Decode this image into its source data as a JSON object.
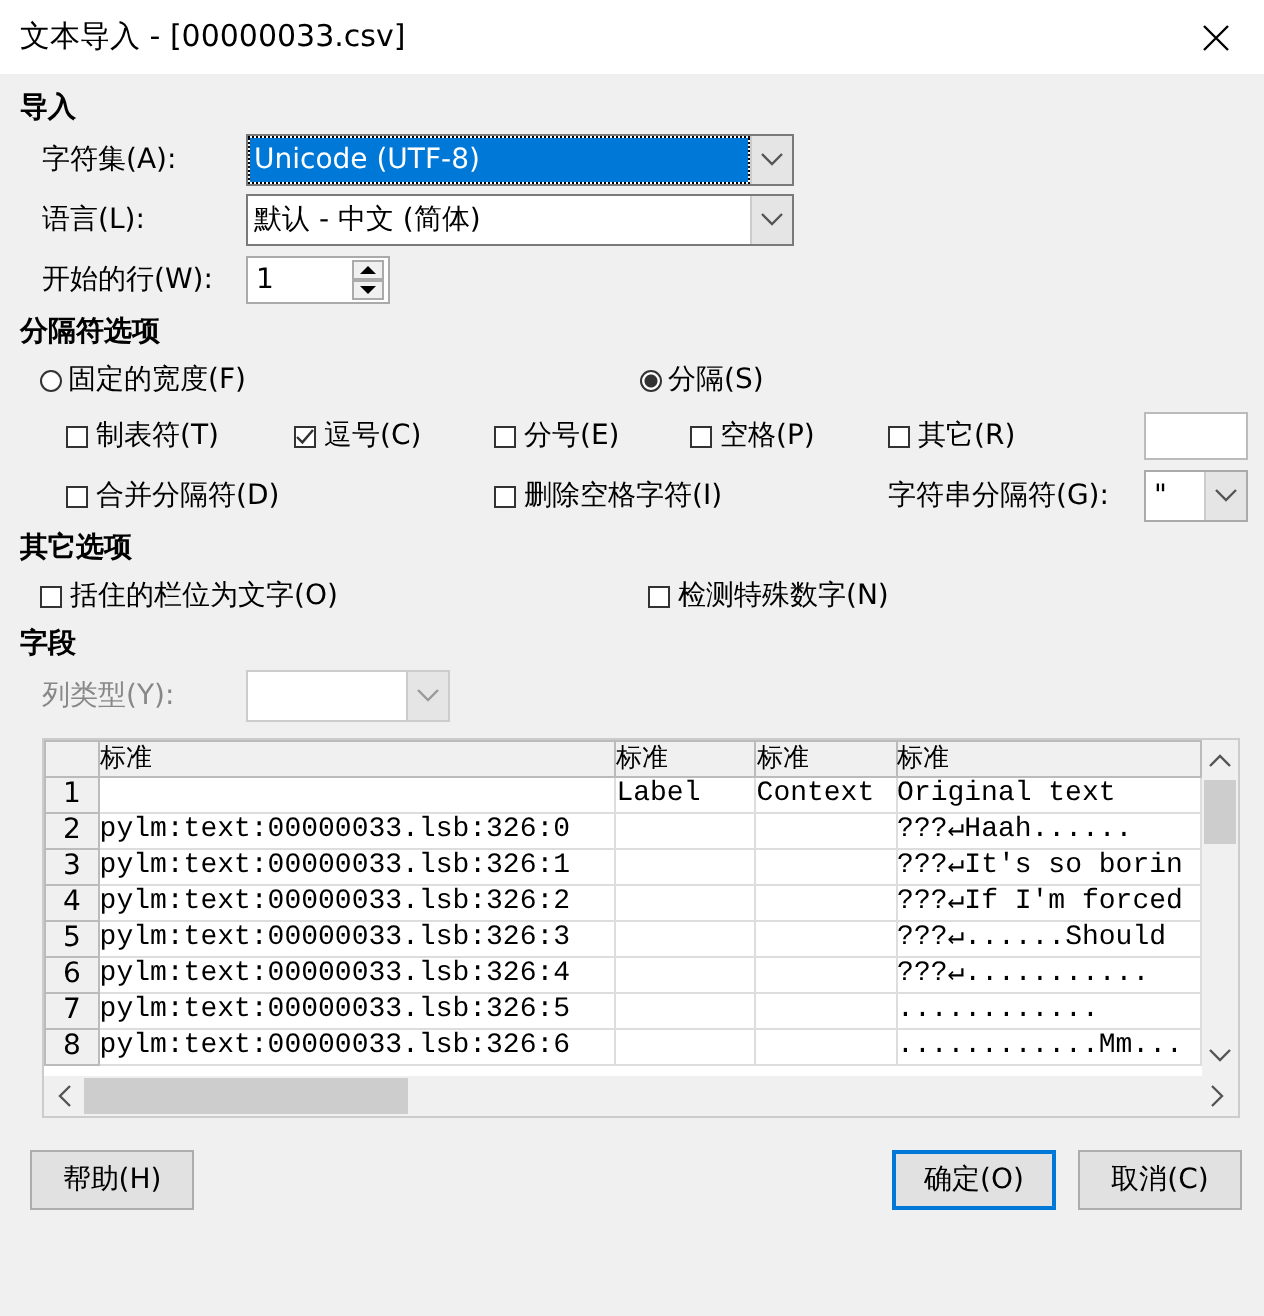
{
  "window": {
    "title": "文本导入 - [00000033.csv]"
  },
  "import": {
    "heading": "导入",
    "fields": [
      {
        "kind": "dropdown",
        "label": "字符集(A):",
        "value": "Unicode (UTF-8)",
        "highlighted": true
      },
      {
        "kind": "dropdown",
        "label": "语言(L):",
        "value": "默认 - 中文 (简体)",
        "highlighted": false
      },
      {
        "kind": "spinner",
        "label": "开始的行(W):",
        "value": "1"
      }
    ]
  },
  "separator_options": {
    "heading": "分隔符选项",
    "modes": [
      {
        "label": "固定的宽度(F)",
        "selected": false
      },
      {
        "label": "分隔(S)",
        "selected": true
      }
    ],
    "separators": [
      {
        "label": "制表符(T)",
        "checked": false
      },
      {
        "label": "逗号(C)",
        "checked": true
      },
      {
        "label": "分号(E)",
        "checked": false
      },
      {
        "label": "空格(P)",
        "checked": false
      },
      {
        "label": "其它(R)",
        "checked": false
      }
    ],
    "extra": [
      {
        "label": "合并分隔符(D)",
        "checked": false
      },
      {
        "label": "删除空格字符(I)",
        "checked": false
      }
    ],
    "string_delimiter": {
      "label": "字符串分隔符(G):",
      "value": "\""
    }
  },
  "other_options": {
    "heading": "其它选项",
    "checkboxes": [
      {
        "label": "括住的栏位为文字(O)",
        "checked": false
      },
      {
        "label": "检测特殊数字(N)",
        "checked": false
      }
    ]
  },
  "fields": {
    "heading": "字段",
    "column_type": {
      "label": "列类型(Y):",
      "disabled": true
    },
    "table": {
      "columns": [
        "标准",
        "标准",
        "标准",
        "标准"
      ],
      "rows": [
        {
          "number": "1",
          "cells": [
            "",
            "Label",
            "Context",
            "Original text"
          ]
        },
        {
          "number": "2",
          "cells": [
            "pylm:text:00000033.lsb:326:0",
            "",
            "",
            "???↵Haah......"
          ]
        },
        {
          "number": "3",
          "cells": [
            "pylm:text:00000033.lsb:326:1",
            "",
            "",
            "???↵It's so borin"
          ]
        },
        {
          "number": "4",
          "cells": [
            "pylm:text:00000033.lsb:326:2",
            "",
            "",
            "???↵If I'm forced"
          ]
        },
        {
          "number": "5",
          "cells": [
            "pylm:text:00000033.lsb:326:3",
            "",
            "",
            "???↵......Should"
          ]
        },
        {
          "number": "6",
          "cells": [
            "pylm:text:00000033.lsb:326:4",
            "",
            "",
            "???↵..........."
          ]
        },
        {
          "number": "7",
          "cells": [
            "pylm:text:00000033.lsb:326:5",
            "",
            "",
            "............"
          ]
        },
        {
          "number": "8",
          "cells": [
            "pylm:text:00000033.lsb:326:6",
            "",
            "",
            "............Mm..."
          ]
        }
      ]
    }
  },
  "buttons": [
    {
      "label": "帮助(H)",
      "default": false
    },
    {
      "label": "确定(O)",
      "default": true
    },
    {
      "label": "取消(C)",
      "default": false
    }
  ]
}
